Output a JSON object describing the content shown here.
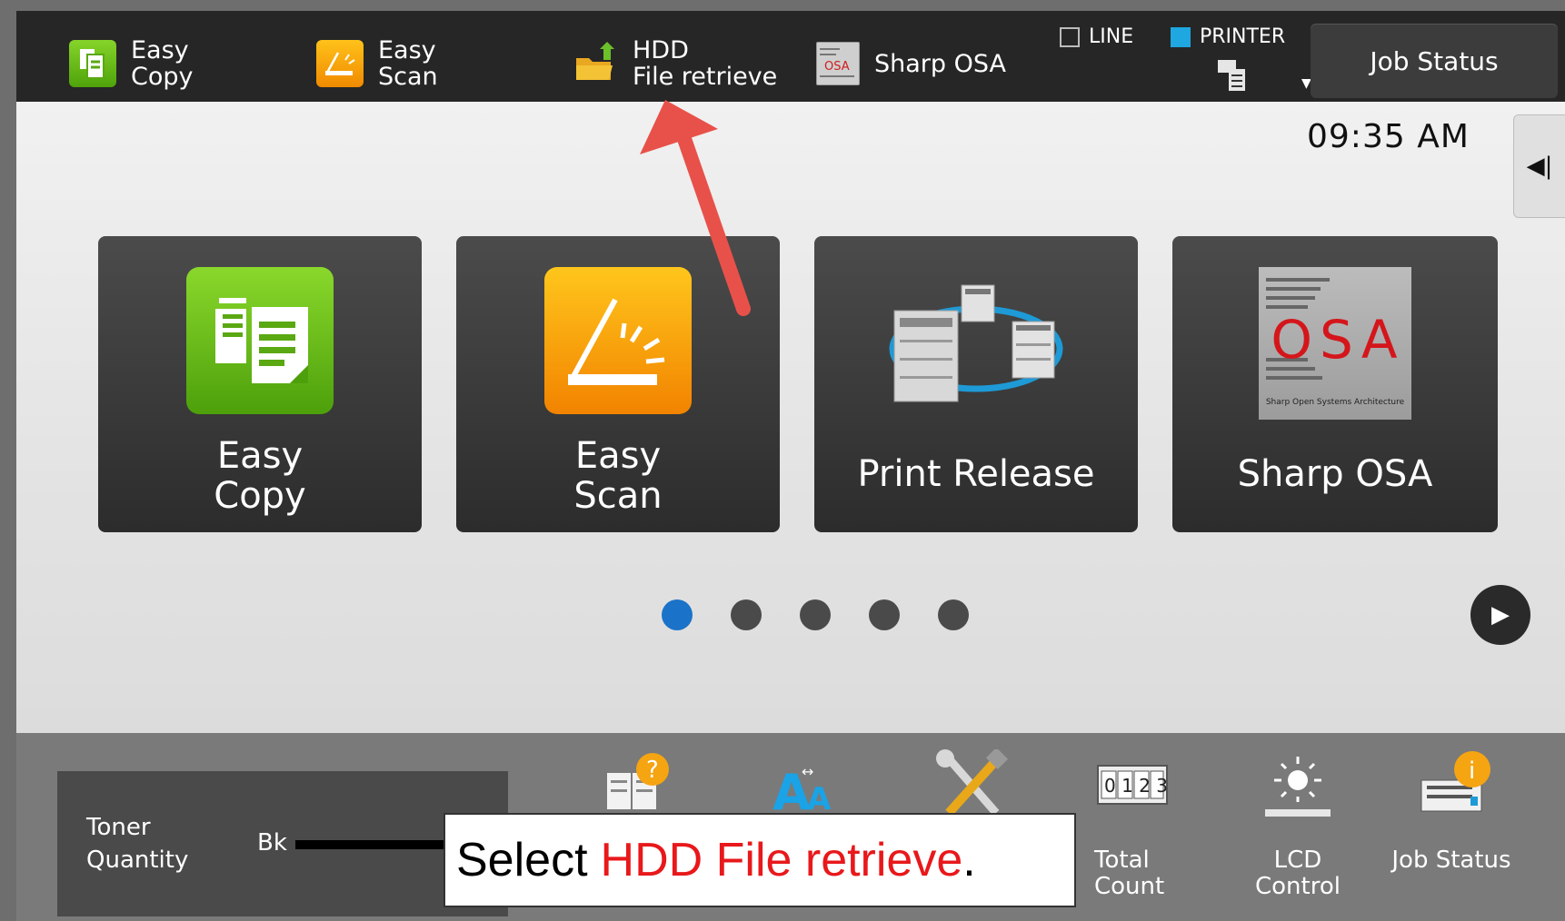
{
  "topbar": {
    "shortcuts": [
      {
        "line1": "Easy",
        "line2": "Copy",
        "icon": "easy-copy-icon"
      },
      {
        "line1": "Easy",
        "line2": "Scan",
        "icon": "easy-scan-icon"
      },
      {
        "line1": "HDD",
        "line2": "File retrieve",
        "icon": "hdd-file-retrieve-icon"
      },
      {
        "label": "Sharp OSA",
        "icon": "sharp-osa-icon"
      }
    ],
    "status": {
      "line": "LINE",
      "printer": "PRINTER"
    },
    "job_status": "Job Status"
  },
  "main": {
    "time": "09:35 AM",
    "tiles": [
      {
        "line1": "Easy",
        "line2": "Copy"
      },
      {
        "line1": "Easy",
        "line2": "Scan"
      },
      {
        "label": "Print Release"
      },
      {
        "label": "Sharp OSA"
      }
    ],
    "osa_logo": "OSA",
    "osa_sub": "Sharp Open Systems Architecture",
    "pages": {
      "count": 5,
      "active": 1
    }
  },
  "bottombar": {
    "toner_line1": "Toner",
    "toner_line2": "Quantity",
    "toner_color": "Bk",
    "items": [
      {
        "line1": "Total",
        "line2": "Count"
      },
      {
        "line1": "LCD",
        "line2": "Control"
      },
      {
        "label": "Job Status"
      }
    ]
  },
  "callout": {
    "prefix": "Select",
    "highlight": "HDD File retrieve",
    "suffix": "."
  },
  "colors": {
    "accent_blue": "#1a73c8",
    "callout_red": "#e8181b",
    "arrow": "#e8514a"
  }
}
